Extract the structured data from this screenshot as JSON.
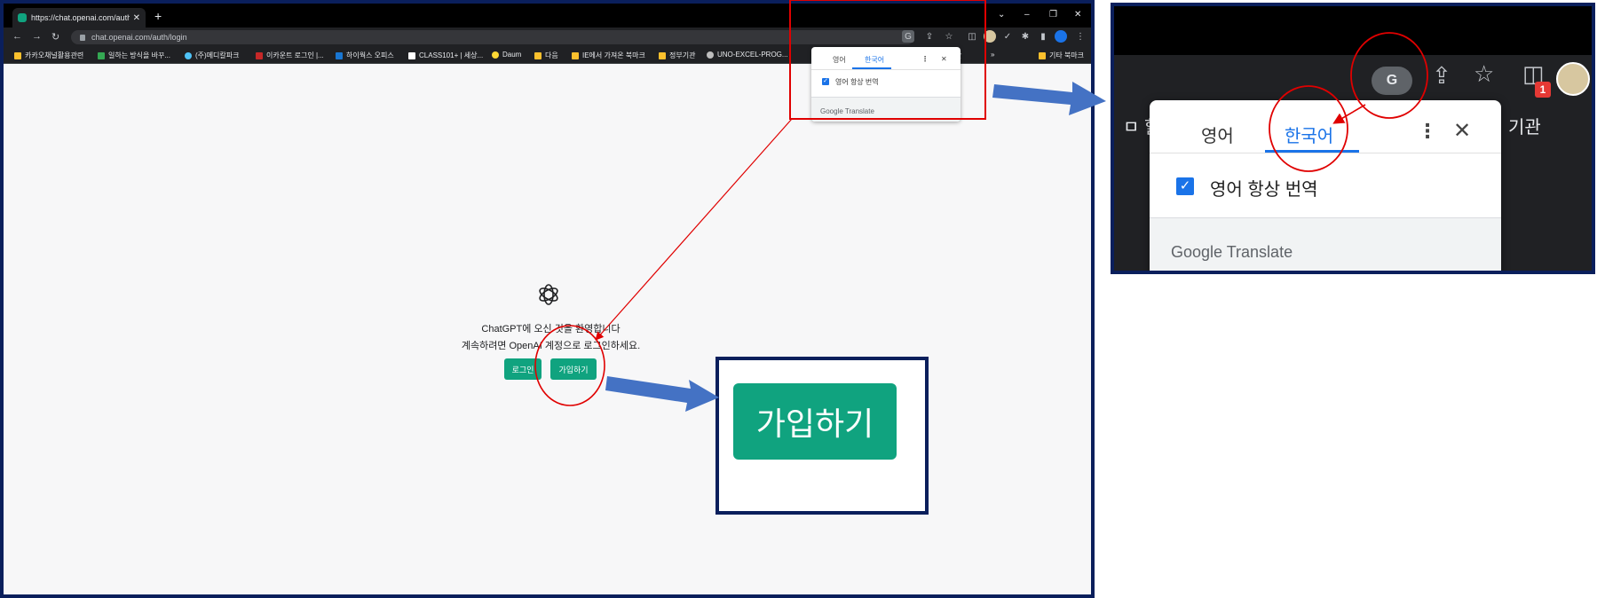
{
  "browser": {
    "tab_title": "https://chat.openai.com/auth/lo",
    "tab_close": "✕",
    "new_tab": "+",
    "url": "chat.openai.com/auth/login",
    "window_controls": [
      "⌄",
      "–",
      "❐",
      "✕"
    ],
    "bookmarks": [
      "카카오채널활용관련",
      "일하는 방식을 바꾸...",
      "(주)메디칼파크",
      "이카운트 로그인 |...",
      "하이웍스 오피스",
      "CLASS101+ | 세상...",
      "Daum",
      "다음",
      "IE에서 가져온 북마크",
      "정부기관",
      "UNO-EXCEL-PROG...",
      "»",
      "기타 북마크"
    ],
    "bookmark_hidden_partial": "관"
  },
  "page": {
    "welcome": "ChatGPT에 오신 것을 환영합니다",
    "subtext": "계속하려면 OpenAI 계정으로 로그인하세요.",
    "login_button": "로그인",
    "signup_button": "가입하기"
  },
  "translate_popup": {
    "source_tab": "영어",
    "target_tab": "한국어",
    "always_translate": "영어 항상 번역",
    "menu_icon": "⋮",
    "close_icon": "✕",
    "footer_brand": "Google Translate",
    "checkbox_mark": "✓"
  },
  "zoom_signup": {
    "label": "가입하기"
  },
  "zoom_panel": {
    "badge": "1",
    "bookmark_left": "ㅁ 할",
    "bookmark_right": "기관"
  },
  "colors": {
    "annotation_red": "#e00000",
    "arrow_blue": "#4472c4",
    "frame_navy": "#0a1f5c",
    "openai_green": "#10a37f",
    "translate_blue": "#1a73e8"
  }
}
